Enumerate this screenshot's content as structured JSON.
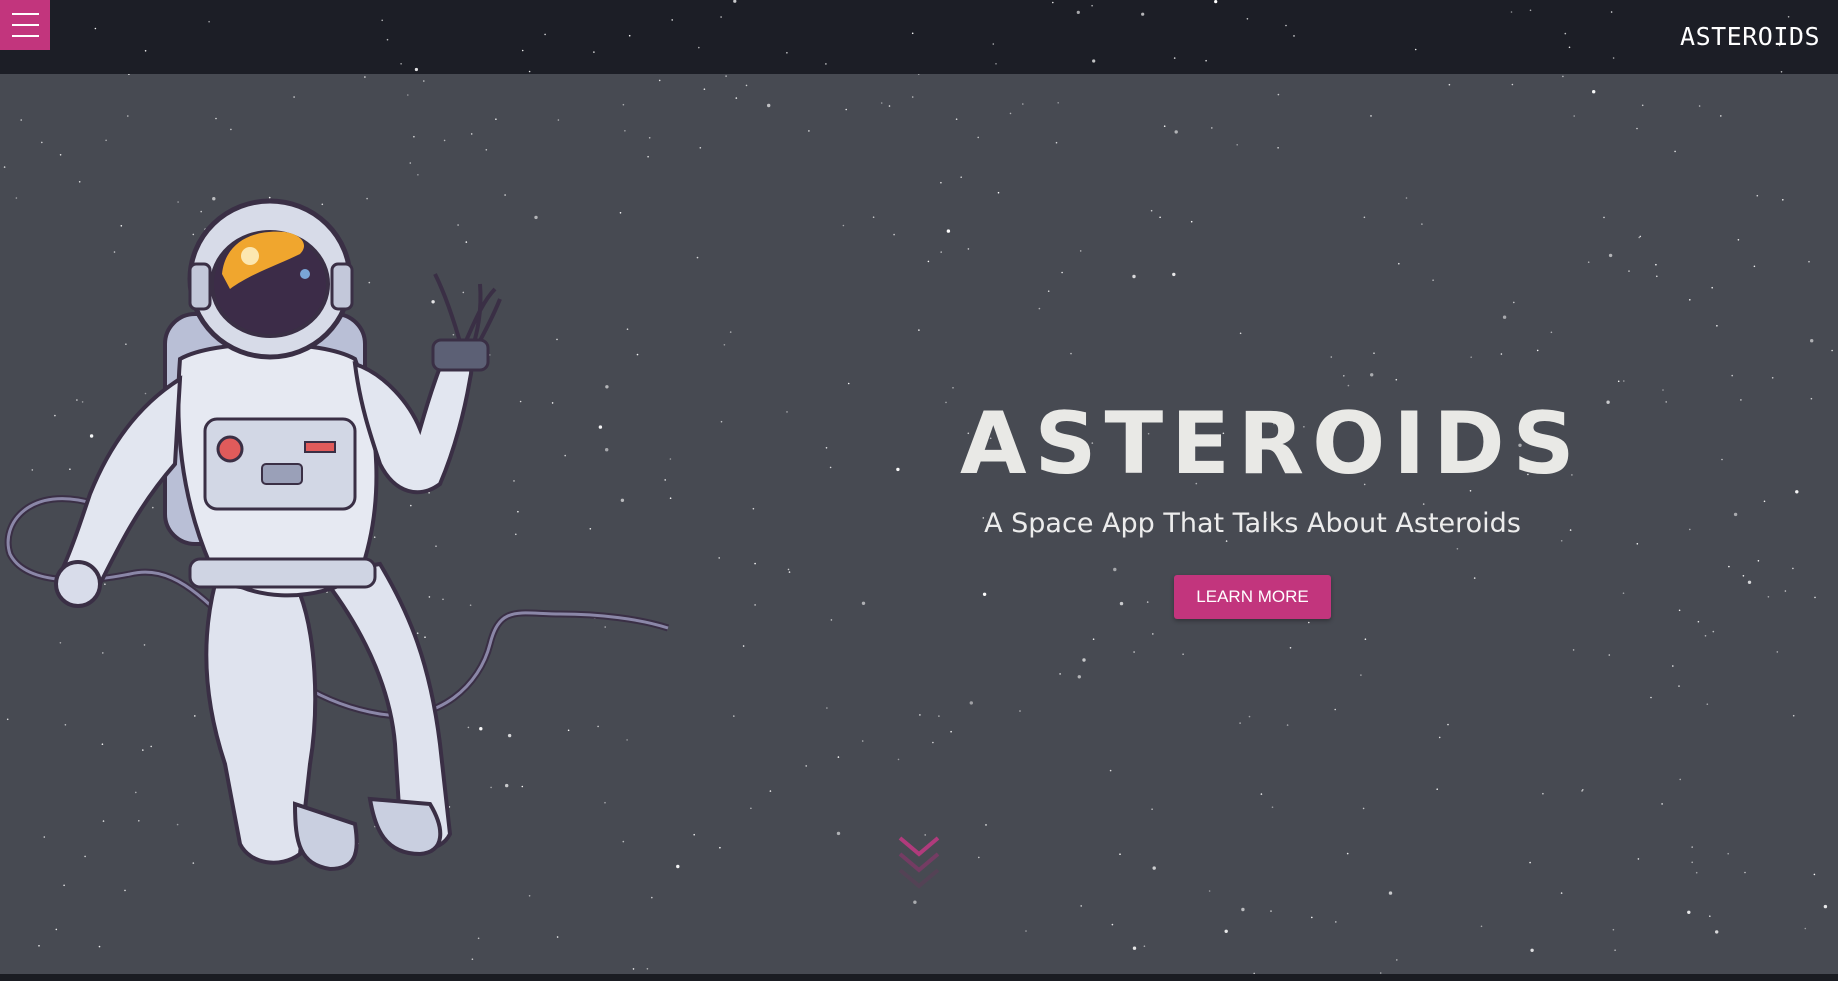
{
  "navbar": {
    "menu_icon": "hamburger-menu-icon",
    "brand": "ASTEROIDS"
  },
  "hero": {
    "title": "ASTEROIDS",
    "subtitle": "A Space App That Talks About Asteroids",
    "cta_label": "LEARN MORE",
    "scroll_icon": "chevron-down-icon",
    "illustration": "astronaut-illustration"
  },
  "colors": {
    "accent": "#c2357d",
    "navbar_bg": "#1c1e26",
    "hero_bg": "#474a52",
    "title_text": "#e9e9e6",
    "subtitle_text": "#ececec"
  }
}
